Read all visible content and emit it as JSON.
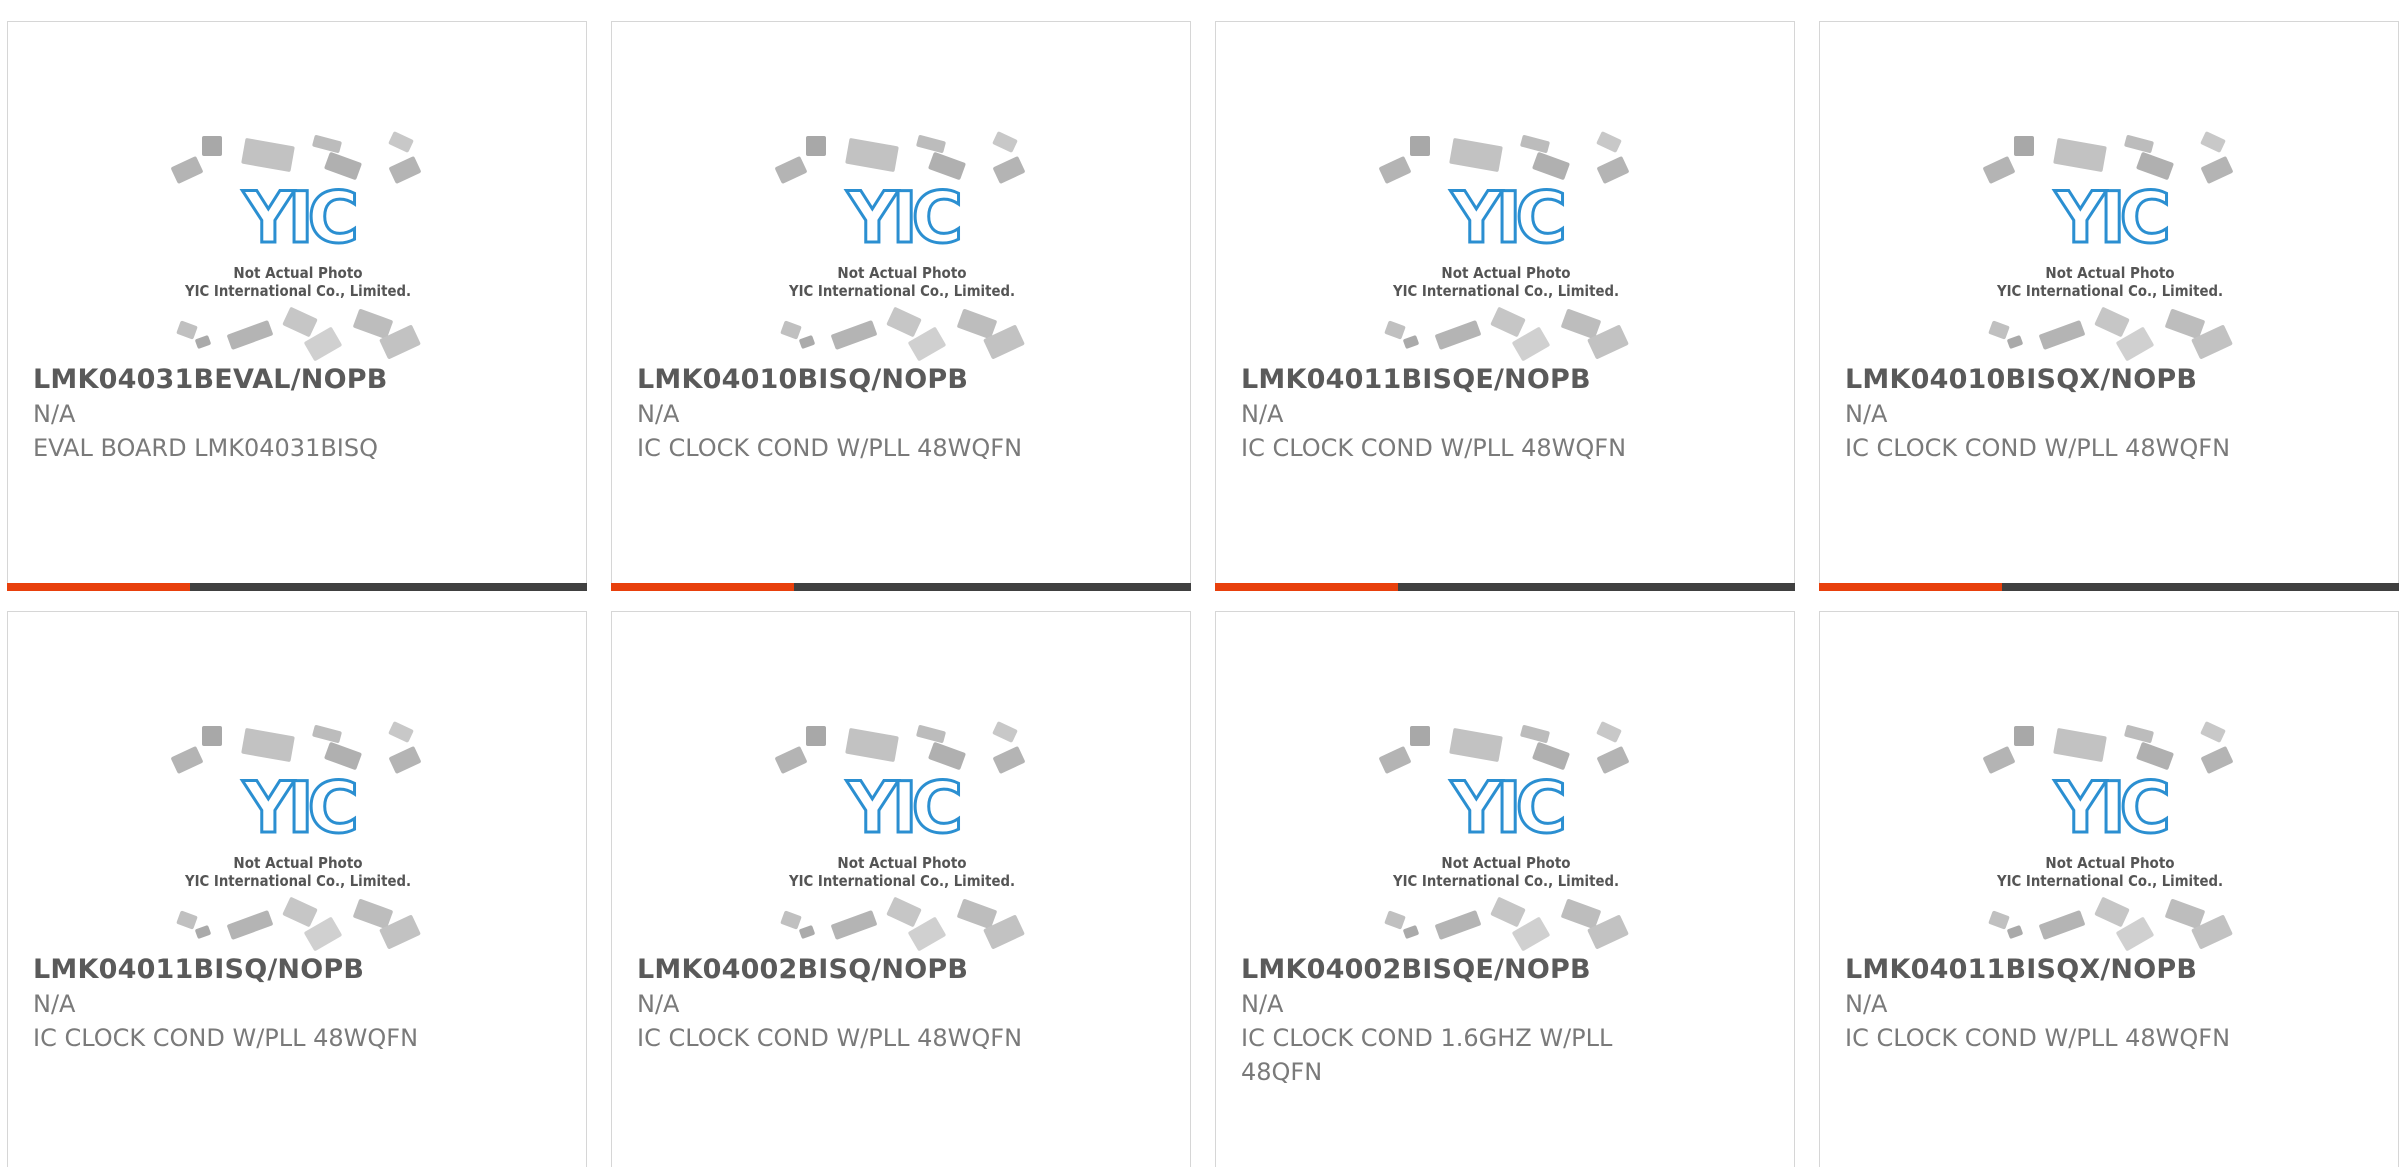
{
  "colors": {
    "accent": "#e8400c",
    "bar_dark": "#404040",
    "logo_blue": "#2b8fd1",
    "chip_gray": "#b4b4b4"
  },
  "placeholder": {
    "line1": "Not Actual Photo",
    "line2": "YIC International Co., Limited.",
    "logo": "YIC"
  },
  "products": [
    {
      "part": "LMK04031BEVAL/NOPB",
      "manufacturer": "N/A",
      "description": "EVAL BOARD LMK04031BISQ"
    },
    {
      "part": "LMK04010BISQ/NOPB",
      "manufacturer": "N/A",
      "description": "IC CLOCK COND W/PLL 48WQFN"
    },
    {
      "part": "LMK04011BISQE/NOPB",
      "manufacturer": "N/A",
      "description": "IC CLOCK COND W/PLL 48WQFN"
    },
    {
      "part": "LMK04010BISQX/NOPB",
      "manufacturer": "N/A",
      "description": "IC CLOCK COND W/PLL 48WQFN"
    },
    {
      "part": "LMK04011BISQ/NOPB",
      "manufacturer": "N/A",
      "description": "IC CLOCK COND W/PLL 48WQFN"
    },
    {
      "part": "LMK04002BISQ/NOPB",
      "manufacturer": "N/A",
      "description": "IC CLOCK COND W/PLL 48WQFN"
    },
    {
      "part": "LMK04002BISQE/NOPB",
      "manufacturer": "N/A",
      "description": "IC CLOCK COND 1.6GHZ W/PLL 48QFN"
    },
    {
      "part": "LMK04011BISQX/NOPB",
      "manufacturer": "N/A",
      "description": "IC CLOCK COND W/PLL 48WQFN"
    }
  ]
}
